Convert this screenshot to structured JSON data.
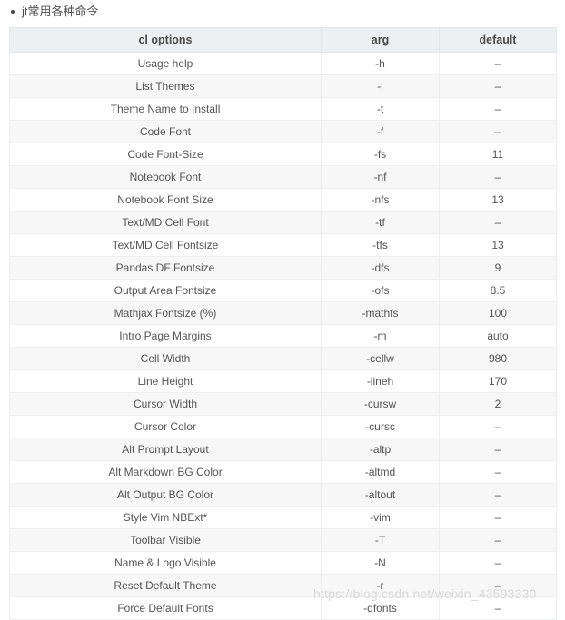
{
  "heading": {
    "bullet_icon": "bullet-dot-icon",
    "text": "jt常用各种命令"
  },
  "table": {
    "columns": [
      "cl options",
      "arg",
      "default"
    ],
    "rows": [
      {
        "option": "Usage help",
        "arg": "-h",
        "default": "–"
      },
      {
        "option": "List Themes",
        "arg": "-l",
        "default": "–"
      },
      {
        "option": "Theme Name to Install",
        "arg": "-t",
        "default": "–"
      },
      {
        "option": "Code Font",
        "arg": "-f",
        "default": "–"
      },
      {
        "option": "Code Font-Size",
        "arg": "-fs",
        "default": "11"
      },
      {
        "option": "Notebook Font",
        "arg": "-nf",
        "default": "–"
      },
      {
        "option": "Notebook Font Size",
        "arg": "-nfs",
        "default": "13"
      },
      {
        "option": "Text/MD Cell Font",
        "arg": "-tf",
        "default": "–"
      },
      {
        "option": "Text/MD Cell Fontsize",
        "arg": "-tfs",
        "default": "13"
      },
      {
        "option": "Pandas DF Fontsize",
        "arg": "-dfs",
        "default": "9"
      },
      {
        "option": "Output Area Fontsize",
        "arg": "-ofs",
        "default": "8.5"
      },
      {
        "option": "Mathjax Fontsize (%)",
        "arg": "-mathfs",
        "default": "100"
      },
      {
        "option": "Intro Page Margins",
        "arg": "-m",
        "default": "auto"
      },
      {
        "option": "Cell Width",
        "arg": "-cellw",
        "default": "980"
      },
      {
        "option": "Line Height",
        "arg": "-lineh",
        "default": "170"
      },
      {
        "option": "Cursor Width",
        "arg": "-cursw",
        "default": "2"
      },
      {
        "option": "Cursor Color",
        "arg": "-cursc",
        "default": "–"
      },
      {
        "option": "Alt Prompt Layout",
        "arg": "-altp",
        "default": "–"
      },
      {
        "option": "Alt Markdown BG Color",
        "arg": "-altmd",
        "default": "–"
      },
      {
        "option": "Alt Output BG Color",
        "arg": "-altout",
        "default": "–"
      },
      {
        "option": "Style Vim NBExt*",
        "arg": "-vim",
        "default": "–"
      },
      {
        "option": "Toolbar Visible",
        "arg": "-T",
        "default": "–"
      },
      {
        "option": "Name & Logo Visible",
        "arg": "-N",
        "default": "–"
      },
      {
        "option": "Reset Default Theme",
        "arg": "-r",
        "default": "–"
      },
      {
        "option": "Force Default Fonts",
        "arg": "-dfonts",
        "default": "–"
      }
    ]
  },
  "watermark": {
    "text": "https://blog.csdn.net/weixin_43593330"
  },
  "colors": {
    "header_bg": "#ecf0f2",
    "stripe_bg": "#f7f7f7",
    "border": "#eceef0",
    "text": "#545454",
    "watermark": "#d8d8d8"
  }
}
